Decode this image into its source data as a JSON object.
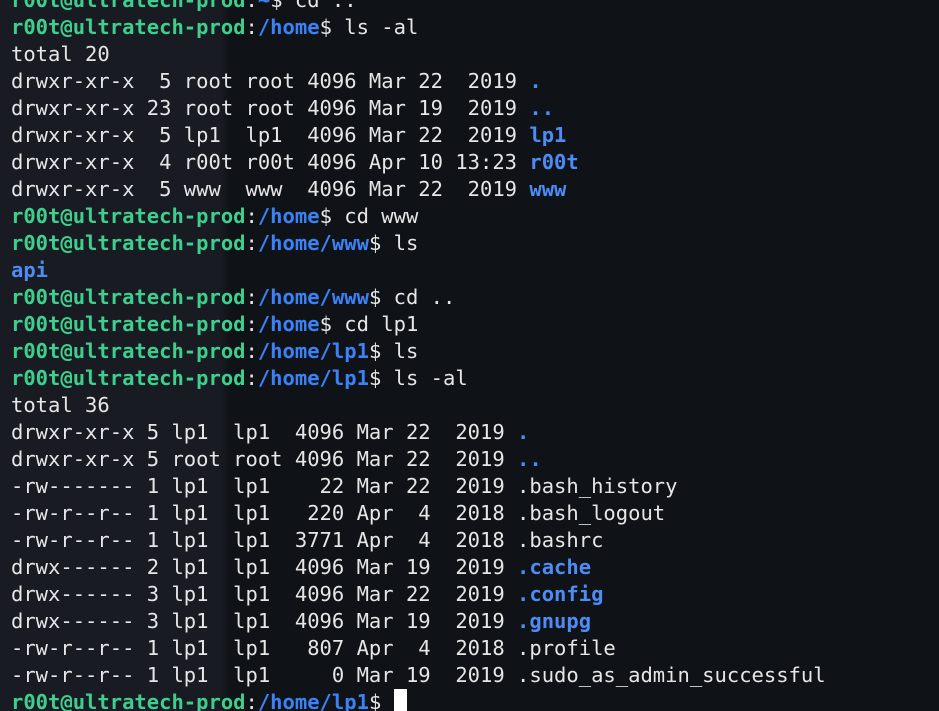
{
  "prompt_user": "r00t@ultratech-prod",
  "lines": [
    {
      "type": "cmd",
      "user": "r00t@ultratech-prod",
      "sep": ":",
      "path": "~",
      "tail": "$ cd ..",
      "partial": true
    },
    {
      "type": "cmd",
      "user": "r00t@ultratech-prod",
      "sep": ":",
      "path": "/home",
      "tail": "$ ls -al"
    },
    {
      "type": "out",
      "text": "total 20"
    },
    {
      "type": "ls",
      "prefix": "drwxr-xr-x  5 root root 4096 Mar 22  2019 ",
      "name": ".",
      "isdir": true
    },
    {
      "type": "ls",
      "prefix": "drwxr-xr-x 23 root root 4096 Mar 19  2019 ",
      "name": "..",
      "isdir": true
    },
    {
      "type": "ls",
      "prefix": "drwxr-xr-x  5 lp1  lp1  4096 Mar 22  2019 ",
      "name": "lp1",
      "isdir": true
    },
    {
      "type": "ls",
      "prefix": "drwxr-xr-x  4 r00t r00t 4096 Apr 10 13:23 ",
      "name": "r00t",
      "isdir": true
    },
    {
      "type": "ls",
      "prefix": "drwxr-xr-x  5 www  www  4096 Mar 22  2019 ",
      "name": "www",
      "isdir": true
    },
    {
      "type": "cmd",
      "user": "r00t@ultratech-prod",
      "sep": ":",
      "path": "/home",
      "tail": "$ cd www"
    },
    {
      "type": "cmd",
      "user": "r00t@ultratech-prod",
      "sep": ":",
      "path": "/home/www",
      "tail": "$ ls"
    },
    {
      "type": "dirout",
      "text": "api"
    },
    {
      "type": "cmd",
      "user": "r00t@ultratech-prod",
      "sep": ":",
      "path": "/home/www",
      "tail": "$ cd .."
    },
    {
      "type": "cmd",
      "user": "r00t@ultratech-prod",
      "sep": ":",
      "path": "/home",
      "tail": "$ cd lp1"
    },
    {
      "type": "cmd",
      "user": "r00t@ultratech-prod",
      "sep": ":",
      "path": "/home/lp1",
      "tail": "$ ls"
    },
    {
      "type": "cmd",
      "user": "r00t@ultratech-prod",
      "sep": ":",
      "path": "/home/lp1",
      "tail": "$ ls -al"
    },
    {
      "type": "out",
      "text": "total 36"
    },
    {
      "type": "ls",
      "prefix": "drwxr-xr-x 5 lp1  lp1  4096 Mar 22  2019 ",
      "name": ".",
      "isdir": true
    },
    {
      "type": "ls",
      "prefix": "drwxr-xr-x 5 root root 4096 Mar 22  2019 ",
      "name": "..",
      "isdir": true
    },
    {
      "type": "ls",
      "prefix": "-rw------- 1 lp1  lp1    22 Mar 22  2019 ",
      "name": ".bash_history",
      "isdir": false
    },
    {
      "type": "ls",
      "prefix": "-rw-r--r-- 1 lp1  lp1   220 Apr  4  2018 ",
      "name": ".bash_logout",
      "isdir": false
    },
    {
      "type": "ls",
      "prefix": "-rw-r--r-- 1 lp1  lp1  3771 Apr  4  2018 ",
      "name": ".bashrc",
      "isdir": false
    },
    {
      "type": "ls",
      "prefix": "drwx------ 2 lp1  lp1  4096 Mar 19  2019 ",
      "name": ".cache",
      "isdir": true
    },
    {
      "type": "ls",
      "prefix": "drwx------ 3 lp1  lp1  4096 Mar 22  2019 ",
      "name": ".config",
      "isdir": true
    },
    {
      "type": "ls",
      "prefix": "drwx------ 3 lp1  lp1  4096 Mar 19  2019 ",
      "name": ".gnupg",
      "isdir": true
    },
    {
      "type": "ls",
      "prefix": "-rw-r--r-- 1 lp1  lp1   807 Apr  4  2018 ",
      "name": ".profile",
      "isdir": false
    },
    {
      "type": "ls",
      "prefix": "-rw-r--r-- 1 lp1  lp1     0 Mar 19  2019 ",
      "name": ".sudo_as_admin_successful",
      "isdir": false
    },
    {
      "type": "prompt",
      "user": "r00t@ultratech-prod",
      "sep": ":",
      "path": "/home/lp1",
      "tail": "$ "
    }
  ],
  "colors": {
    "background": "#0f1216",
    "user": "#3ecf8e",
    "path": "#3b82f6",
    "directory": "#4d8bf5",
    "text": "#e6e6e6",
    "cursor": "#ffffff"
  }
}
